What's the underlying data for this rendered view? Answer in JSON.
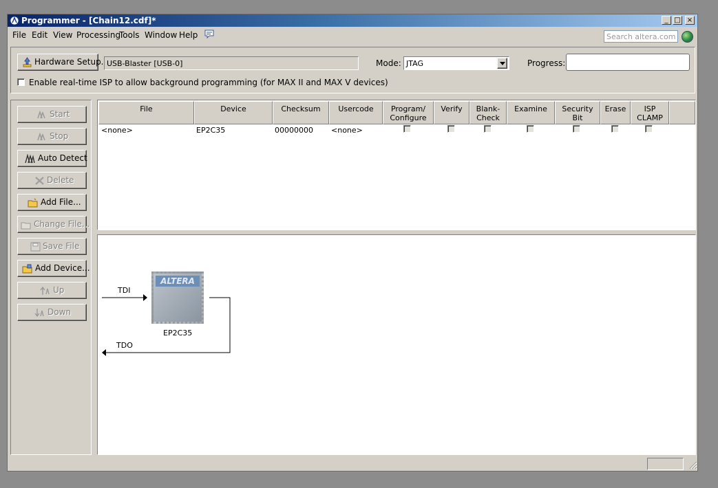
{
  "window": {
    "title": "Programmer - [Chain12.cdf]*",
    "controls": {
      "minimize": "_",
      "maximize": "□",
      "close": "×"
    }
  },
  "menu": {
    "items": [
      "File",
      "Edit",
      "View",
      "Processing",
      "Tools",
      "Window",
      "Help"
    ],
    "search_placeholder": "Search altera.com"
  },
  "toolbar": {
    "hardware_setup_label": "Hardware Setup...",
    "hardware_value": "USB-Blaster [USB-0]",
    "mode_label": "Mode:",
    "mode_value": "JTAG",
    "progress_label": "Progress:",
    "progress_value": "",
    "isp_checkbox_label": "Enable real-time ISP to allow background programming (for MAX II and MAX V devices)",
    "isp_checked": false
  },
  "side_buttons": [
    {
      "label": "Start",
      "enabled": false,
      "icon": "start-icon"
    },
    {
      "label": "Stop",
      "enabled": false,
      "icon": "stop-icon"
    },
    {
      "label": "Auto Detect",
      "enabled": true,
      "icon": "auto-detect-icon"
    },
    {
      "label": "Delete",
      "enabled": false,
      "icon": "delete-icon"
    },
    {
      "label": "Add File...",
      "enabled": true,
      "icon": "add-file-icon"
    },
    {
      "label": "Change File...",
      "enabled": false,
      "icon": "change-file-icon"
    },
    {
      "label": "Save File",
      "enabled": false,
      "icon": "save-file-icon"
    },
    {
      "label": "Add Device...",
      "enabled": true,
      "icon": "add-device-icon"
    },
    {
      "label": "Up",
      "enabled": false,
      "icon": "up-icon"
    },
    {
      "label": "Down",
      "enabled": false,
      "icon": "down-icon"
    }
  ],
  "table": {
    "columns": [
      "File",
      "Device",
      "Checksum",
      "Usercode",
      "Program/\nConfigure",
      "Verify",
      "Blank-\nCheck",
      "Examine",
      "Security\nBit",
      "Erase",
      "ISP\nCLAMP"
    ],
    "rows": [
      {
        "file": "<none>",
        "device": "EP2C35",
        "checksum": "00000000",
        "usercode": "<none>",
        "checks": [
          false,
          false,
          false,
          false,
          false,
          false,
          false
        ]
      }
    ]
  },
  "diagram": {
    "tdi_label": "TDI",
    "tdo_label": "TDO",
    "device_label": "EP2C35",
    "chip_logo": "ALTERA"
  },
  "colors": {
    "titlebar_start": "#0a246a",
    "titlebar_end": "#a6caf0",
    "face": "#d4d0c8"
  }
}
